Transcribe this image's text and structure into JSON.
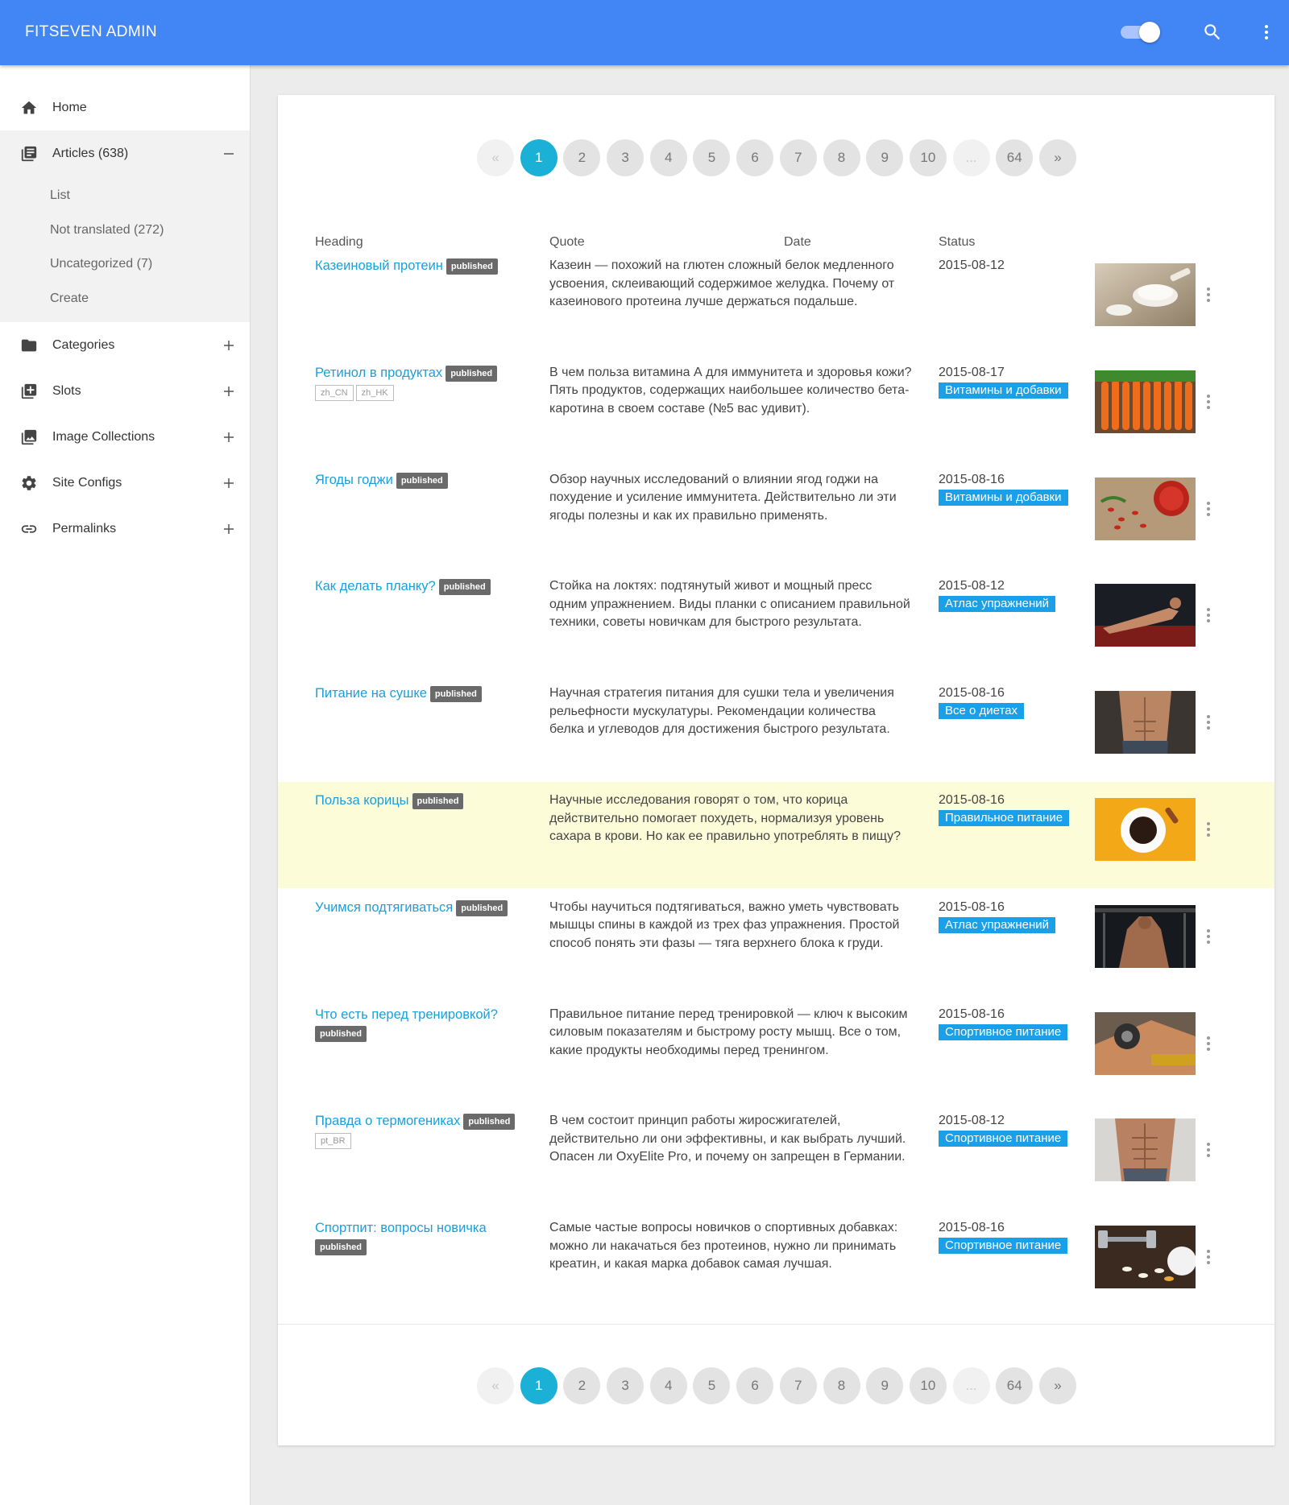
{
  "header": {
    "app_title": "FITSEVEN ADMIN",
    "theme_toggle_on": true
  },
  "sidebar": {
    "items": [
      {
        "label": "Home",
        "icon": "home-icon"
      },
      {
        "label": "Articles (638)",
        "icon": "articles-icon",
        "expanded": true,
        "sub": [
          "List",
          "Not translated (272)",
          "Uncategorized (7)",
          "Create"
        ]
      },
      {
        "label": "Categories",
        "icon": "folder-icon"
      },
      {
        "label": "Slots",
        "icon": "add-box-icon"
      },
      {
        "label": "Image Collections",
        "icon": "photo-library-icon"
      },
      {
        "label": "Site Configs",
        "icon": "gear-icon"
      },
      {
        "label": "Permalinks",
        "icon": "link-icon"
      }
    ]
  },
  "pagination": {
    "prev": "«",
    "next": "»",
    "ellipsis": "...",
    "pages": [
      "1",
      "2",
      "3",
      "4",
      "5",
      "6",
      "7",
      "8",
      "9",
      "10"
    ],
    "last": "64",
    "current": "1"
  },
  "table": {
    "columns": {
      "heading": "Heading",
      "quote": "Quote",
      "date": "Date",
      "status": "Status"
    },
    "rows": [
      {
        "title": "Казеиновый протеин",
        "status": "published",
        "locales": [],
        "quote": "Казеин — похожий на глютен сложный белок медленного усвоения, склеивающий содержимое желудка. Почему от казеинового протеина лучше держаться подальше.",
        "date": "2015-08-12",
        "category": "",
        "image": "protein-scoop"
      },
      {
        "title": "Ретинол в продуктах",
        "status": "published",
        "locales": [
          "zh_CN",
          "zh_HK"
        ],
        "quote": "В чем польза витамина А для иммунитета и здоровья кожи? Пять продуктов, содержащих наибольшее количество бета-каротина в своем составе (№5 вас удивит).",
        "date": "2015-08-17",
        "category": "Витамины и добавки",
        "image": "carrots"
      },
      {
        "title": "Ягоды годжи",
        "status": "published",
        "locales": [],
        "quote": "Обзор научных исследований о влиянии ягод годжи на похудение и усиление иммунитета. Действительно ли эти ягоды полезны и как их правильно применять.",
        "date": "2015-08-16",
        "category": "Витамины и добавки",
        "image": "goji"
      },
      {
        "title": "Как делать планку?",
        "status": "published",
        "locales": [],
        "quote": "Стойка на локтях: подтянутый живот и мощный пресс одним упражнением. Виды планки с описанием правильной техники, советы новичкам для быстрого результата.",
        "date": "2015-08-12",
        "category": "Атлас упражнений",
        "image": "plank"
      },
      {
        "title": "Питание на сушке",
        "status": "published",
        "locales": [],
        "quote": "Научная стратегия питания для сушки тела и увеличения рельефности мускулатуры. Рекомендации количества белка и углеводов для достижения быстрого результата.",
        "date": "2015-08-16",
        "category": "Все о диетах",
        "image": "torso"
      },
      {
        "title": "Польза корицы",
        "status": "published",
        "locales": [],
        "quote": "Научные исследования говорят о том, что корица действительно помогает похудеть, нормализуя уровень сахара в крови. Но как ее правильно употреблять в пищу?",
        "date": "2015-08-16",
        "category": "Правильное питание",
        "image": "coffee",
        "highlight": true
      },
      {
        "title": "Учимся подтягиваться",
        "status": "published",
        "locales": [],
        "quote": "Чтобы научиться подтягиваться, важно уметь чувствовать мышцы спины в каждой из трех фаз упражнения. Простой способ понять эти фазы — тяга верхнего блока к груди.",
        "date": "2015-08-16",
        "category": "Атлас упражнений",
        "image": "gym"
      },
      {
        "title": "Что есть перед тренировкой?",
        "status": "published",
        "locales": [],
        "quote": "Правильное питание перед тренировкой — ключ к высоким силовым показателям и быстрому росту мышц. Все о том, какие продукты необходимы перед тренингом.",
        "date": "2015-08-16",
        "category": "Спортивное питание",
        "image": "dumbbell-arm"
      },
      {
        "title": "Правда о термогениках",
        "status": "published",
        "locales": [
          "pt_BR"
        ],
        "quote": "В чем состоит принцип работы жиросжигателей, действительно ли они эффективны, и как выбрать лучший. Опасен ли OxyElite Pro, и почему он запрещен в Германии.",
        "date": "2015-08-12",
        "category": "Спортивное питание",
        "image": "abs"
      },
      {
        "title": "Спортпит: вопросы новичка",
        "status": "published",
        "locales": [],
        "quote": "Самые частые вопросы новичков о спортивных добавках: можно ли накачаться без протеинов, нужно ли принимать креатин, и какая марка добавок самая лучшая.",
        "date": "2015-08-16",
        "category": "Спортивное питание",
        "image": "pills"
      }
    ]
  },
  "colors": {
    "appbar": "#4285f4",
    "accent": "#1bb1d7",
    "link": "#1a9fdc",
    "category_badge": "#1a9fe9",
    "highlight_row": "#fdfcd9"
  }
}
